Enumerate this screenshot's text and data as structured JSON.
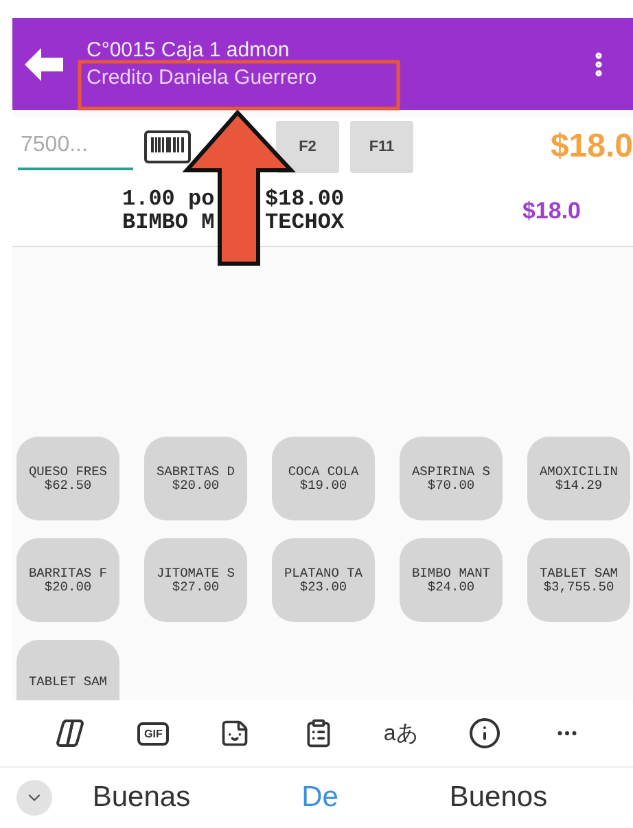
{
  "header": {
    "title": "C°0015 Caja 1 admon",
    "subtitle": "Credito Daniela Guerrero"
  },
  "toolbar": {
    "search": {
      "placeholder": "7500..."
    },
    "keys": [
      {
        "kind": "barcode"
      },
      {
        "kind": "gap"
      },
      {
        "kind": "text",
        "label": "F2"
      },
      {
        "kind": "text",
        "label": "F11"
      }
    ],
    "total": "$18.0"
  },
  "line_item": {
    "quantity": "1.00 po",
    "unit_price": "$18.00",
    "name_start": "BIMBO M",
    "name_end": "TECHOX",
    "amount": "$18.0"
  },
  "products": [
    {
      "name": "QUESO FRES",
      "price": "$62.50"
    },
    {
      "name": "SABRITAS D",
      "price": "$20.00"
    },
    {
      "name": "COCA COLA",
      "price": "$19.00"
    },
    {
      "name": "ASPIRINA S",
      "price": "$70.00"
    },
    {
      "name": "AMOXICILIN",
      "price": "$14.29"
    },
    {
      "name": "BARRITAS F",
      "price": "$20.00"
    },
    {
      "name": "JITOMATE S",
      "price": "$27.00"
    },
    {
      "name": "PLATANO TA",
      "price": "$23.00"
    },
    {
      "name": "BIMBO MANT",
      "price": "$24.00"
    },
    {
      "name": "TABLET SAM",
      "price": "$3,755.50"
    },
    {
      "name": "TABLET SAM"
    }
  ],
  "keyboard": {
    "tools": [
      {
        "kind": "copilot"
      },
      {
        "kind": "gif",
        "label": "GIF"
      },
      {
        "kind": "sticker"
      },
      {
        "kind": "clipboard"
      },
      {
        "kind": "translate",
        "label": "aあ"
      },
      {
        "kind": "info"
      },
      {
        "kind": "more"
      }
    ],
    "suggestions": [
      {
        "text": "Buenas",
        "selected": false
      },
      {
        "text": "De",
        "selected": true
      },
      {
        "text": "Buenos",
        "selected": false
      }
    ]
  }
}
